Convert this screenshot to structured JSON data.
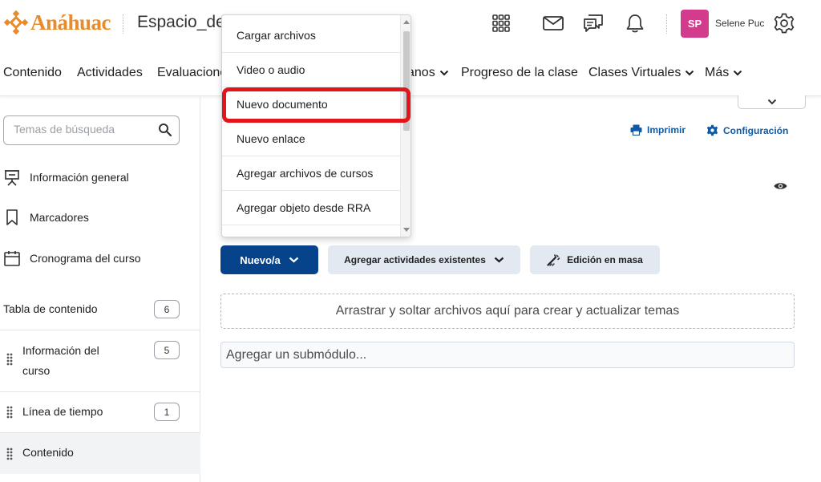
{
  "header": {
    "brand": "Anáhuac",
    "course_title": "Espacio_de",
    "user_initials": "SP",
    "user_name": "Selene Puc",
    "icons": [
      "apps-grid-icon",
      "mail-icon",
      "chat-icon",
      "bell-icon",
      "gear-icon"
    ]
  },
  "nav": {
    "items": [
      {
        "label": "Contenido",
        "dropdown": false
      },
      {
        "label": "Actividades",
        "dropdown": false
      },
      {
        "label": "Evaluacione",
        "dropdown": false
      },
      {
        "label": "anos",
        "dropdown": true
      },
      {
        "label": "Progreso de la clase",
        "dropdown": false
      },
      {
        "label": "Clases Virtuales",
        "dropdown": true
      },
      {
        "label": "Más",
        "dropdown": true
      }
    ]
  },
  "sidebar": {
    "search_placeholder": "Temas de búsqueda",
    "links": [
      {
        "label": "Información general",
        "icon": "presentation-icon"
      },
      {
        "label": "Marcadores",
        "icon": "bookmark-icon"
      },
      {
        "label": "Cronograma del curso",
        "icon": "calendar-icon"
      }
    ],
    "toc_label": "Tabla de contenido",
    "toc_count": "6",
    "modules": [
      {
        "label_line1": "Información del",
        "label_line2": "curso",
        "count": "5"
      },
      {
        "label": "Línea de tiempo",
        "count": "1"
      },
      {
        "label": "Contenido",
        "active": true
      }
    ]
  },
  "main": {
    "print_label": "Imprimir",
    "settings_label": "Configuración",
    "new_button": "Nuevo/a",
    "add_existing_button": "Agregar actividades existentes",
    "bulk_edit_button": "Edición en masa",
    "dropzone_text": "Arrastrar y soltar archivos aquí para crear y actualizar temas",
    "submodule_placeholder": "Agregar un submódulo..."
  },
  "menu": {
    "items": [
      "Cargar archivos",
      "Video o audio",
      "Nuevo documento",
      "Nuevo enlace",
      "Agregar archivos de cursos",
      "Agregar objeto desde RRA"
    ],
    "highlighted": "Nuevo documento"
  },
  "colors": {
    "brand_orange": "#e98a2b",
    "primary_blue": "#06438b",
    "link_blue": "#0d5ba8",
    "avatar_pink": "#d33c8c",
    "highlight_red": "#e3151a"
  }
}
